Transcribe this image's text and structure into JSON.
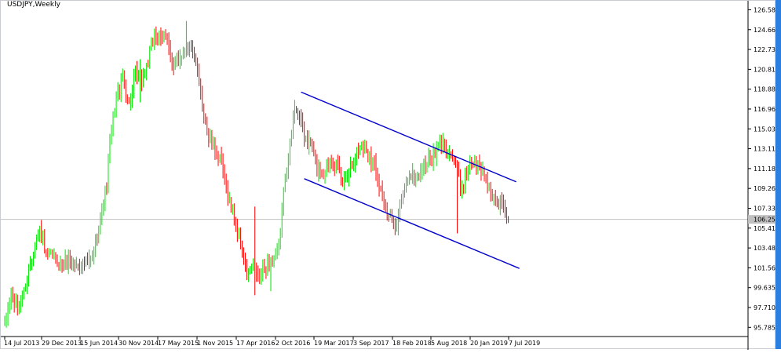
{
  "window": {
    "title": "USDJPY,Weekly",
    "border_color": "#2a7fe0"
  },
  "chart_data": {
    "type": "candlestick",
    "symbol": "USDJPY",
    "timeframe": "Weekly",
    "title": "USDJPY,Weekly",
    "y_ticks": [
      "126.585",
      "124.660",
      "122.735",
      "120.810",
      "118.885",
      "116.960",
      "115.035",
      "113.110",
      "111.185",
      "109.260",
      "107.335",
      "105.410",
      "103.485",
      "101.560",
      "99.635",
      "97.710",
      "95.785"
    ],
    "x_ticks": [
      "14 Jul 2013",
      "29 Dec 2013",
      "15 Jun 2014",
      "30 Nov 2014",
      "17 May 2015",
      "1 Nov 2015",
      "17 Apr 2016",
      "2 Oct 2016",
      "19 Mar 2017",
      "3 Sep 2017",
      "18 Feb 2018",
      "5 Aug 2018",
      "20 Jan 2019",
      "7 Jul 2019"
    ],
    "ylim": [
      95.2,
      127.0
    ],
    "bid_level": {
      "label": "106.258",
      "value": 106.258
    },
    "channel_lines": [
      {
        "name": "upper",
        "from": {
          "week": 186,
          "price": 118.6
        },
        "to": {
          "week": 321,
          "price": 109.9
        }
      },
      {
        "name": "lower",
        "from": {
          "week": 188,
          "price": 110.2
        },
        "to": {
          "week": 323,
          "price": 101.5
        }
      }
    ],
    "bull_color": "#00e600",
    "bear_color": "#ff0000",
    "channel_color": "#0000cc",
    "anchor_closes": [
      [
        0,
        96.0
      ],
      [
        4,
        99.0
      ],
      [
        8,
        97.4
      ],
      [
        12,
        99.2
      ],
      [
        16,
        102.0
      ],
      [
        20,
        104.5
      ],
      [
        22,
        105.2
      ],
      [
        26,
        102.5
      ],
      [
        30,
        102.8
      ],
      [
        35,
        101.8
      ],
      [
        40,
        102.4
      ],
      [
        45,
        101.8
      ],
      [
        50,
        101.9
      ],
      [
        55,
        102.4
      ],
      [
        58,
        104.5
      ],
      [
        62,
        108.0
      ],
      [
        64,
        109.5
      ],
      [
        66,
        114.0
      ],
      [
        70,
        118.0
      ],
      [
        74,
        120.0
      ],
      [
        78,
        117.5
      ],
      [
        82,
        120.2
      ],
      [
        86,
        119.6
      ],
      [
        90,
        121.5
      ],
      [
        94,
        124.2
      ],
      [
        98,
        123.5
      ],
      [
        102,
        124.4
      ],
      [
        104,
        122.0
      ],
      [
        106,
        120.5
      ],
      [
        108,
        121.8
      ],
      [
        112,
        122.5
      ],
      [
        114,
        123.2
      ],
      [
        118,
        122.6
      ],
      [
        120,
        121.0
      ],
      [
        124,
        117.5
      ],
      [
        128,
        114.2
      ],
      [
        132,
        113.0
      ],
      [
        136,
        111.5
      ],
      [
        140,
        108.5
      ],
      [
        144,
        106.5
      ],
      [
        148,
        103.8
      ],
      [
        152,
        100.8
      ],
      [
        156,
        101.8
      ],
      [
        160,
        100.5
      ],
      [
        164,
        101.8
      ],
      [
        168,
        102.0
      ],
      [
        172,
        103.5
      ],
      [
        176,
        110.5
      ],
      [
        180,
        114.5
      ],
      [
        182,
        117.5
      ],
      [
        184,
        116.8
      ],
      [
        188,
        114.2
      ],
      [
        192,
        113.5
      ],
      [
        196,
        111.2
      ],
      [
        200,
        110.8
      ],
      [
        204,
        112.0
      ],
      [
        208,
        111.5
      ],
      [
        212,
        109.8
      ],
      [
        216,
        111.2
      ],
      [
        220,
        112.5
      ],
      [
        224,
        113.5
      ],
      [
        228,
        112.8
      ],
      [
        232,
        111.5
      ],
      [
        236,
        109.2
      ],
      [
        240,
        106.5
      ],
      [
        244,
        106.0
      ],
      [
        246,
        105.8
      ],
      [
        250,
        108.8
      ],
      [
        254,
        110.8
      ],
      [
        258,
        110.2
      ],
      [
        262,
        111.2
      ],
      [
        266,
        112.0
      ],
      [
        270,
        112.5
      ],
      [
        274,
        113.6
      ],
      [
        278,
        113.0
      ],
      [
        280,
        112.6
      ],
      [
        284,
        111.0
      ],
      [
        286,
        109.5
      ],
      [
        288,
        109.8
      ],
      [
        292,
        112.0
      ],
      [
        296,
        111.6
      ],
      [
        300,
        110.8
      ],
      [
        304,
        109.5
      ],
      [
        306,
        108.0
      ],
      [
        310,
        107.8
      ],
      [
        312,
        108.2
      ],
      [
        316,
        106.2
      ]
    ],
    "long_shadows": [
      {
        "week": 85,
        "high": 121.8,
        "low": 117.6
      },
      {
        "week": 114,
        "high": 125.5,
        "low": 122.0
      },
      {
        "week": 157,
        "high": 107.5,
        "low": 98.9
      },
      {
        "week": 167,
        "high": 102.5,
        "low": 99.3
      },
      {
        "week": 247,
        "high": 107.3,
        "low": 104.7
      },
      {
        "week": 284,
        "high": 112.0,
        "low": 104.9
      },
      {
        "week": 318,
        "high": 108.8,
        "low": 105.3
      }
    ]
  }
}
